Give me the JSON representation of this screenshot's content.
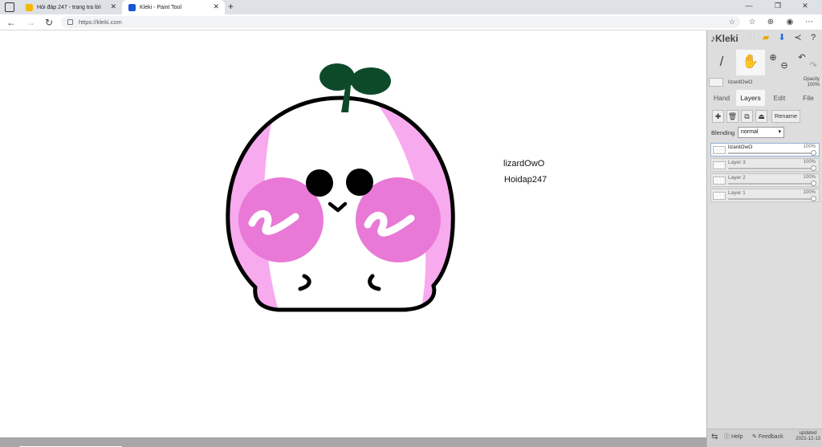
{
  "browser": {
    "tabs": [
      {
        "title": "Hỏi đáp 247 - trang tra lời",
        "favicon_color": "#f5b800"
      },
      {
        "title": "Kleki - Paint Tool",
        "favicon_color": "#1a56d6"
      }
    ],
    "url": "https://kleki.com",
    "icons": {
      "back": "back-arrow-icon",
      "forward": "forward-arrow-icon",
      "reload": "reload-icon",
      "new_tab": "plus-icon",
      "minimize": "minimize-icon",
      "restore": "restore-icon",
      "close": "close-icon"
    }
  },
  "canvas": {
    "texts": [
      "lizardOwO",
      "Hoidap247"
    ],
    "colors": {
      "pink_light": "#f8aaee",
      "pink_dark": "#e879d6",
      "leaf": "#0d4a2a",
      "outline": "#000000"
    }
  },
  "panel": {
    "logo": "Kleki",
    "current_layer": {
      "name": "lizardOwO",
      "opacity_label": "Opacity",
      "opacity_value": "100%"
    },
    "tabs": [
      {
        "label": "Hand",
        "active": false
      },
      {
        "label": "Layers",
        "active": true
      },
      {
        "label": "Edit",
        "active": false
      },
      {
        "label": "File",
        "active": false
      }
    ],
    "rename_label": "Rename",
    "blending_label": "Blending",
    "blending_value": "normal",
    "layers": [
      {
        "name": "lizardOwO",
        "opacity": "100%",
        "active": true
      },
      {
        "name": "Layer 3",
        "opacity": "100%",
        "active": false
      },
      {
        "name": "Layer 2",
        "opacity": "100%",
        "active": false
      },
      {
        "name": "Layer 1",
        "opacity": "100%",
        "active": false
      }
    ],
    "bottom": {
      "help": "Help",
      "feedback": "Feedback",
      "updated_label": "updated",
      "updated_date": "2021-12-13"
    }
  }
}
